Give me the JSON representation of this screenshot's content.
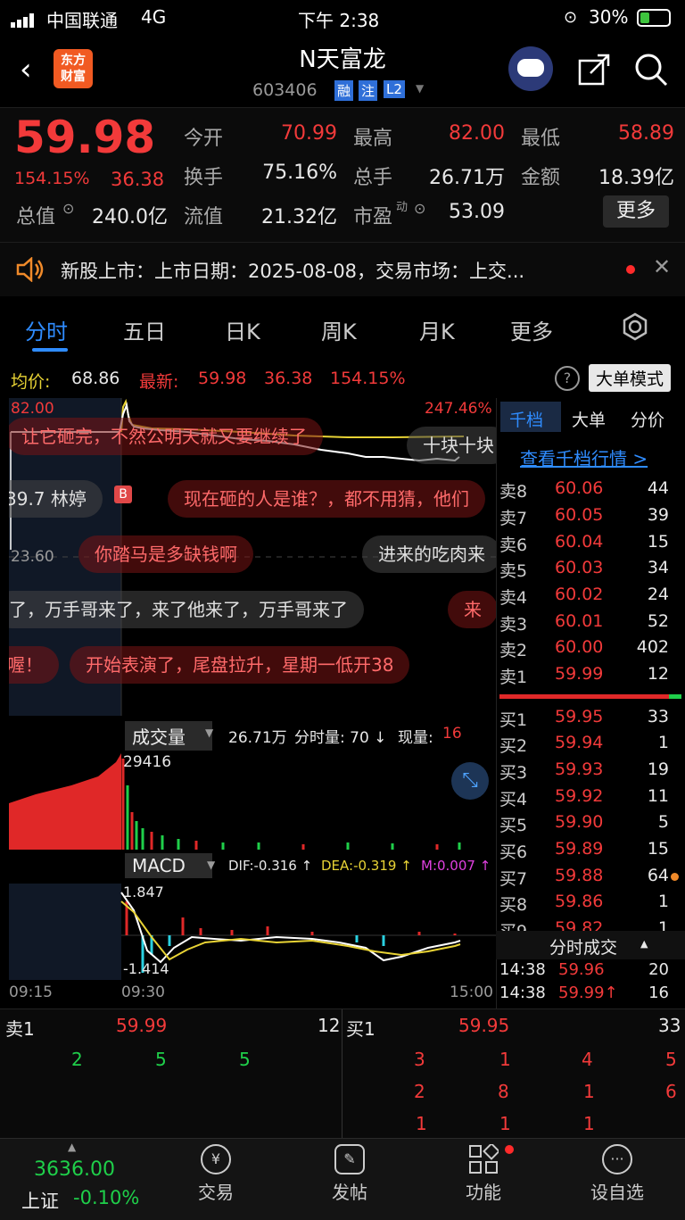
{
  "status_bar": {
    "carrier": "中国联通",
    "network": "4G",
    "time": "下午 2:38",
    "battery": "30%"
  },
  "header": {
    "logo_text_1": "东方",
    "logo_text_2": "财富",
    "title": "N天富龙",
    "code": "603406",
    "tags": [
      "融",
      "注",
      "L2"
    ]
  },
  "quote": {
    "price": "59.98",
    "change_pct": "154.15%",
    "change": "36.38",
    "open_label": "今开",
    "open": "70.99",
    "high_label": "最高",
    "high": "82.00",
    "low_label": "最低",
    "low": "58.89",
    "turnover_label": "换手",
    "turnover": "75.16%",
    "volume_label": "总手",
    "volume": "26.71万",
    "amount_label": "金额",
    "amount": "18.39亿",
    "mcap_label": "总值",
    "mcap": "240.0亿",
    "float_label": "流值",
    "float": "21.32亿",
    "pe_label": "市盈",
    "pe_sup": "动",
    "pe": "53.09",
    "more": "更多"
  },
  "notice": {
    "text": "新股上市：上市日期：2025-08-08，交易市场：上交..."
  },
  "tabs": [
    {
      "label": "分时"
    },
    {
      "label": "五日"
    },
    {
      "label": "日K"
    },
    {
      "label": "周K"
    },
    {
      "label": "月K"
    },
    {
      "label": "更多"
    }
  ],
  "info_line": {
    "avg_label": "均价:",
    "avg": "68.86",
    "latest_label": "最新:",
    "latest": "59.98",
    "change": "36.38",
    "pct": "154.15%",
    "mode_button": "大单模式"
  },
  "chart": {
    "price_top": "82.00",
    "pct_top": "247.46%",
    "price_mid": "23.60",
    "b_marker": "B",
    "time_start": "09:15",
    "time_mid": "09:30",
    "time_end": "15:00"
  },
  "danmu": [
    {
      "text": "让它砸完，不然公明天就又要继续了"
    },
    {
      "text": "十块十块"
    },
    {
      "text": "39.7 林婷"
    },
    {
      "text": "现在砸的人是谁？，都不用猜，他们"
    },
    {
      "text": "你踏马是多缺钱啊"
    },
    {
      "text": "进来的吃肉来"
    },
    {
      "text": "了，万手哥来了，来了他来了，万手哥来了"
    },
    {
      "text": "来"
    },
    {
      "text": "喔！"
    },
    {
      "text": "开始表演了，尾盘拉升，星期一低开38"
    }
  ],
  "volume_panel": {
    "selector": "成交量",
    "total": "26.71万",
    "minute_label": "分时量: 70 ↓",
    "now_label": "现量:",
    "now": "16",
    "max": "29416"
  },
  "macd_panel": {
    "selector": "MACD",
    "dif": "DIF:-0.316 ↑",
    "dea": "DEA:-0.319 ↑",
    "m": "M:0.007 ↑",
    "top": "1.847",
    "bottom": "-1.414"
  },
  "orderbook": {
    "tabs": [
      "千档",
      "大单",
      "分价"
    ],
    "link": "查看千档行情 >",
    "asks": [
      {
        "label": "卖8",
        "price": "60.06",
        "vol": "44"
      },
      {
        "label": "卖7",
        "price": "60.05",
        "vol": "39"
      },
      {
        "label": "卖6",
        "price": "60.04",
        "vol": "15"
      },
      {
        "label": "卖5",
        "price": "60.03",
        "vol": "34"
      },
      {
        "label": "卖4",
        "price": "60.02",
        "vol": "24"
      },
      {
        "label": "卖3",
        "price": "60.01",
        "vol": "52"
      },
      {
        "label": "卖2",
        "price": "60.00",
        "vol": "402"
      },
      {
        "label": "卖1",
        "price": "59.99",
        "vol": "12"
      }
    ],
    "bids": [
      {
        "label": "买1",
        "price": "59.95",
        "vol": "33"
      },
      {
        "label": "买2",
        "price": "59.94",
        "vol": "1"
      },
      {
        "label": "买3",
        "price": "59.93",
        "vol": "19"
      },
      {
        "label": "买4",
        "price": "59.92",
        "vol": "11"
      },
      {
        "label": "买5",
        "price": "59.90",
        "vol": "5"
      },
      {
        "label": "买6",
        "price": "59.89",
        "vol": "15"
      },
      {
        "label": "买7",
        "price": "59.88",
        "vol": "64"
      },
      {
        "label": "买8",
        "price": "59.86",
        "vol": "1"
      },
      {
        "label": "买9",
        "price": "59.82",
        "vol": "1"
      }
    ],
    "ticks_title": "分时成交",
    "ticks": [
      {
        "time": "14:38",
        "price": "59.96",
        "vol": "20"
      },
      {
        "time": "14:38",
        "price": "59.99↑",
        "vol": "16"
      }
    ]
  },
  "queue": {
    "sell_label": "卖1",
    "sell_price": "59.99",
    "sell_vol": "12",
    "buy_label": "买1",
    "buy_price": "59.95",
    "buy_vol": "33",
    "sell_row1": [
      "2",
      "5",
      "5"
    ],
    "buy_row1": [
      "3",
      "1",
      "4",
      "5"
    ],
    "buy_row2": [
      "2",
      "8",
      "1",
      "6"
    ],
    "buy_row3": [
      "1",
      "1",
      "1"
    ]
  },
  "bottom_nav": {
    "index_value": "3636.00",
    "index_name": "上证",
    "index_change": "-0.10%",
    "items": [
      {
        "label": "交易"
      },
      {
        "label": "发帖"
      },
      {
        "label": "功能"
      },
      {
        "label": "设自选"
      }
    ]
  },
  "colors": {
    "up": "#f23a3a",
    "down": "#1fcf4a",
    "accent": "#2f8cff",
    "avg_line": "#e8d335"
  }
}
